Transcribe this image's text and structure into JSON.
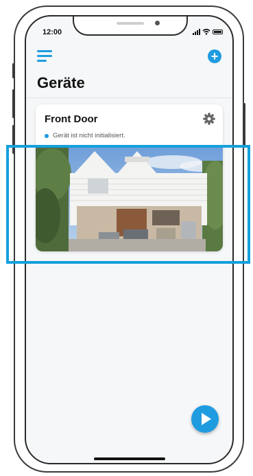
{
  "status_bar": {
    "time": "12:00"
  },
  "header": {
    "title": "Geräte",
    "add_label": "+"
  },
  "device": {
    "name": "Front Door",
    "status": "Gerät ist nicht initialisiert."
  },
  "colors": {
    "accent": "#1f9be0",
    "highlight": "#14a0dc"
  }
}
